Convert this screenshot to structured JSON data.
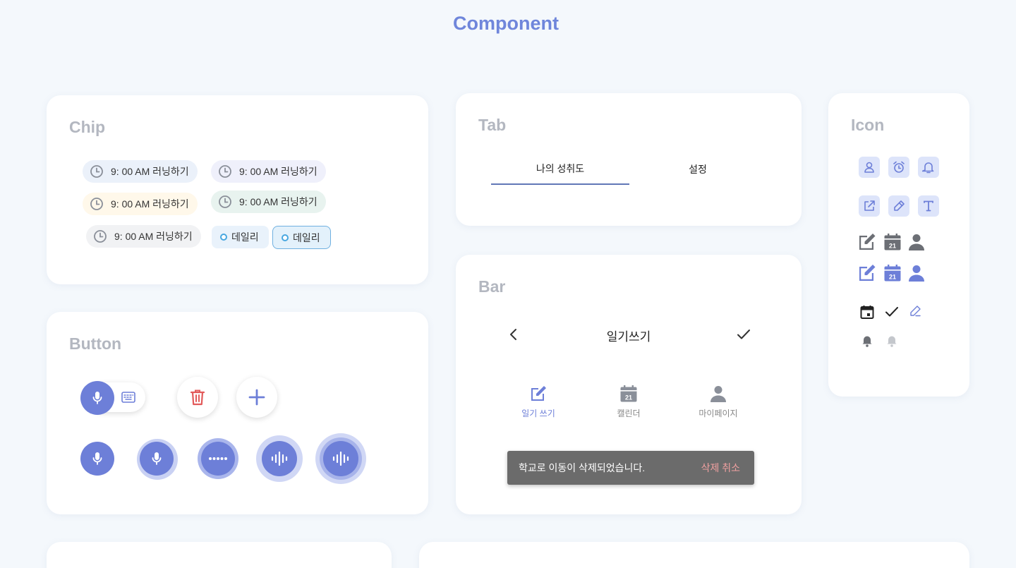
{
  "page": {
    "title": "Component"
  },
  "chip": {
    "title": "Chip",
    "items": [
      {
        "label": "9: 00 AM 러닝하기",
        "variant": "blue"
      },
      {
        "label": "9: 00 AM 러닝하기",
        "variant": "purple"
      },
      {
        "label": "9: 00 AM 러닝하기",
        "variant": "yellow"
      },
      {
        "label": "9: 00 AM 러닝하기",
        "variant": "green"
      },
      {
        "label": "9: 00 AM 러닝하기",
        "variant": "gray"
      }
    ],
    "tags": [
      {
        "label": "데일리",
        "active": false
      },
      {
        "label": "데일리",
        "active": true
      }
    ]
  },
  "tab": {
    "title": "Tab",
    "tabs": [
      {
        "label": "나의 성취도",
        "active": true
      },
      {
        "label": "설정",
        "active": false
      }
    ]
  },
  "icon": {
    "title": "Icon",
    "boxed_row1": [
      "user-icon",
      "alarm-clock-icon",
      "bell-icon"
    ],
    "boxed_row2": [
      "external-link-icon",
      "pen-icon",
      "text-icon"
    ],
    "gray_row": [
      "edit-icon",
      "calendar-icon",
      "user-icon"
    ],
    "blue_row": [
      "edit-icon",
      "calendar-icon",
      "user-icon"
    ],
    "misc_row": [
      "calendar-icon",
      "check-icon",
      "pencil-icon"
    ],
    "bell_row": [
      "bell-icon",
      "bell-icon"
    ],
    "calendar_day": "21"
  },
  "button": {
    "title": "Button",
    "colors": {
      "accent": "#6d7fd8",
      "danger": "#e25b5b"
    }
  },
  "bar": {
    "title": "Bar",
    "header_title": "일기쓰기",
    "nav": [
      {
        "label": "일기 쓰기",
        "icon": "edit-icon",
        "active": true
      },
      {
        "label": "캘린더",
        "icon": "calendar-icon",
        "active": false
      },
      {
        "label": "마이페이지",
        "icon": "user-icon",
        "active": false
      }
    ],
    "calendar_day": "21",
    "snackbar": {
      "message": "학교로 이동이 삭제되었습니다.",
      "action": "삭제 취소"
    }
  }
}
